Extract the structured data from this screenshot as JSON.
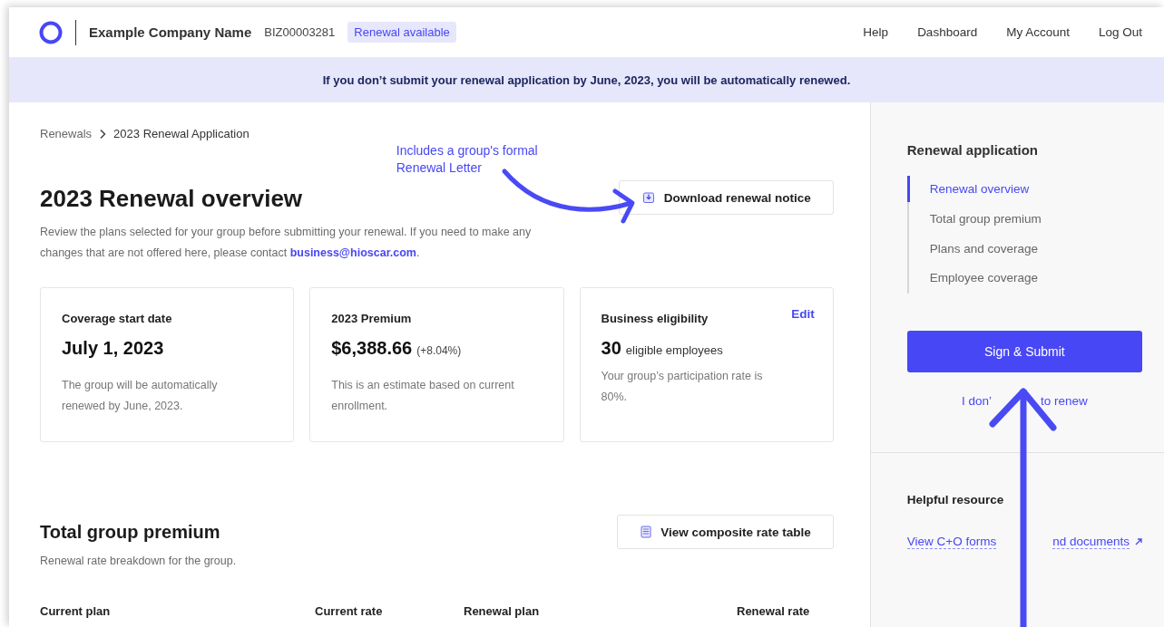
{
  "header": {
    "company": "Example Company Name",
    "account_id": "BIZ00003281",
    "badge": "Renewal available",
    "nav": [
      "Help",
      "Dashboard",
      "My Account",
      "Log Out"
    ]
  },
  "banner": "If you don’t submit your renewal application by June, 2023, you will be automatically renewed.",
  "breadcrumb": [
    "Renewals",
    "2023 Renewal Application"
  ],
  "annotation": "Includes a group's formal Renewal Letter",
  "overview": {
    "title": "2023 Renewal overview",
    "download_button": "Download renewal notice",
    "description": "Review the plans selected for your group before submitting your renewal. If you need to make any changes that are not offered here, please contact ",
    "email": "business@hioscar.com",
    "description_end": "."
  },
  "cards": [
    {
      "kind": "date",
      "label": "Coverage start date",
      "value": "July 1, 2023",
      "note": "The group will be automatically renewed by June, 2023."
    },
    {
      "kind": "premium",
      "label": "2023 Premium",
      "value": "$6,388.66",
      "change": "(+8.04%)",
      "note": "This is an estimate based on current enrollment."
    },
    {
      "kind": "eligibility",
      "label": "Business eligibility",
      "action": "Edit",
      "value": "30",
      "unit": "eligible employees",
      "note": "Your group’s participation rate is 80%."
    }
  ],
  "premium": {
    "title": "Total group premium",
    "button": "View composite rate table",
    "description": "Renewal rate breakdown for the group.",
    "columns": [
      "Current plan",
      "Current rate",
      "Renewal plan",
      "Renewal rate"
    ]
  },
  "sidebar": {
    "title": "Renewal application",
    "nav": [
      {
        "label": "Renewal overview",
        "selected": true
      },
      {
        "label": "Total group premium",
        "selected": false
      },
      {
        "label": "Plans and coverage",
        "selected": false
      },
      {
        "label": "Employee coverage",
        "selected": false
      }
    ],
    "submit": "Sign & Submit",
    "decline_parts": [
      "I don’",
      "to renew"
    ],
    "resources_title": "Helpful resource",
    "resource_link_parts": [
      "View C+O forms",
      "nd documents"
    ]
  }
}
